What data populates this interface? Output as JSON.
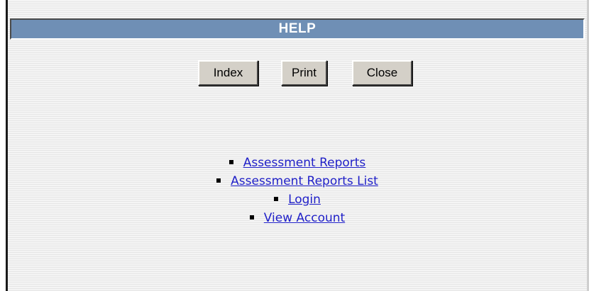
{
  "header": {
    "title": "HELP"
  },
  "toolbar": {
    "index_label": "Index",
    "print_label": "Print",
    "close_label": "Close"
  },
  "links": [
    {
      "label": "Assessment Reports"
    },
    {
      "label": "Assessment Reports List"
    },
    {
      "label": "Login"
    },
    {
      "label": "View Account"
    }
  ],
  "colors": {
    "header_bg": "#6f8fb5",
    "link": "#1f1fc8",
    "button_bg": "#d4d0c8"
  }
}
